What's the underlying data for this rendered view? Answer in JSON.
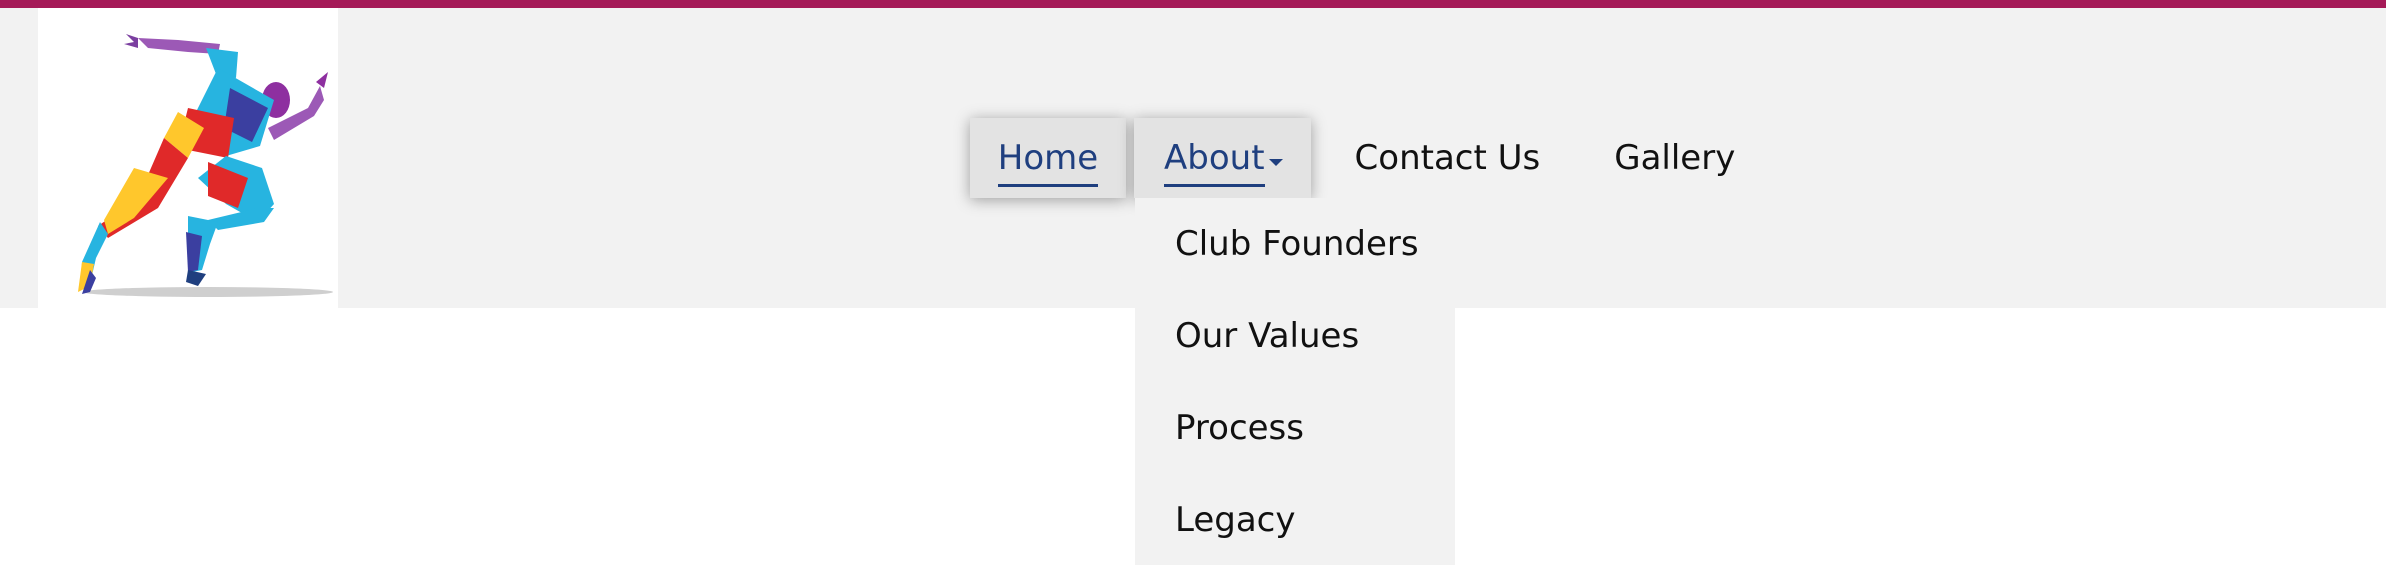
{
  "colors": {
    "stripe": "#a51a58",
    "nav_active": "#1f3f7f",
    "text": "#111111",
    "header_bg": "#f2f2f2"
  },
  "logo": {
    "icon": "running-athlete-logo"
  },
  "nav": {
    "items": [
      {
        "label": "Home"
      },
      {
        "label": "About"
      },
      {
        "label": "Contact Us"
      },
      {
        "label": "Gallery"
      }
    ],
    "about_dropdown": [
      {
        "label": "Club Founders"
      },
      {
        "label": "Our Values"
      },
      {
        "label": "Process"
      },
      {
        "label": "Legacy"
      }
    ]
  }
}
